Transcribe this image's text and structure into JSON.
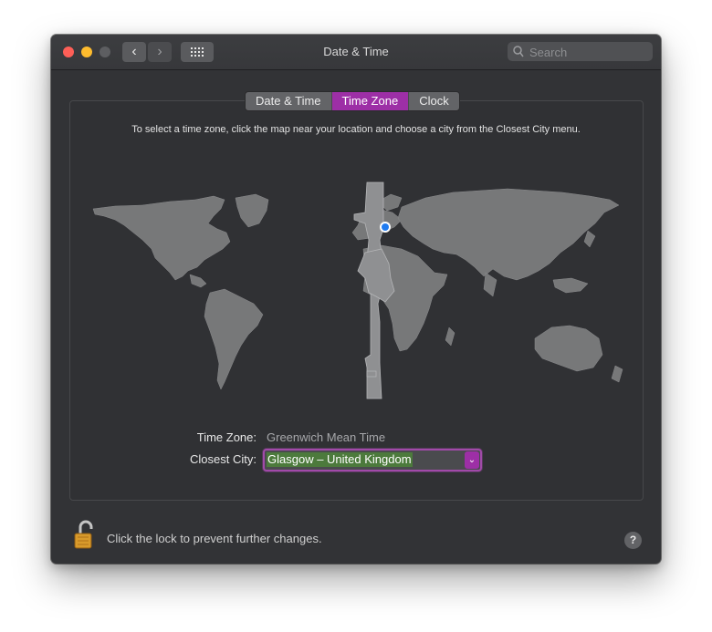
{
  "window": {
    "title": "Date & Time"
  },
  "toolbar": {
    "back_icon": "‹",
    "forward_icon": "›"
  },
  "search": {
    "placeholder": "Search",
    "value": ""
  },
  "tabs": [
    {
      "label": "Date & Time",
      "active": false
    },
    {
      "label": "Time Zone",
      "active": true
    },
    {
      "label": "Clock",
      "active": false
    }
  ],
  "instructions": "To select a time zone, click the map near your location and choose a city from the Closest City menu.",
  "time_zone": {
    "label": "Time Zone:",
    "value": "Greenwich Mean Time"
  },
  "closest_city": {
    "label": "Closest City:",
    "value": "Glasgow – United Kingdom"
  },
  "footer": {
    "lock_text": "Click the lock to prevent further changes.",
    "help": "?"
  },
  "colors": {
    "accent": "#9d2fa6",
    "selection": "#4c7a3c",
    "background": "#323336"
  },
  "icons": [
    "back-chevron-icon",
    "forward-chevron-icon",
    "grid-icon",
    "search-icon",
    "lock-open-icon",
    "help-icon"
  ]
}
